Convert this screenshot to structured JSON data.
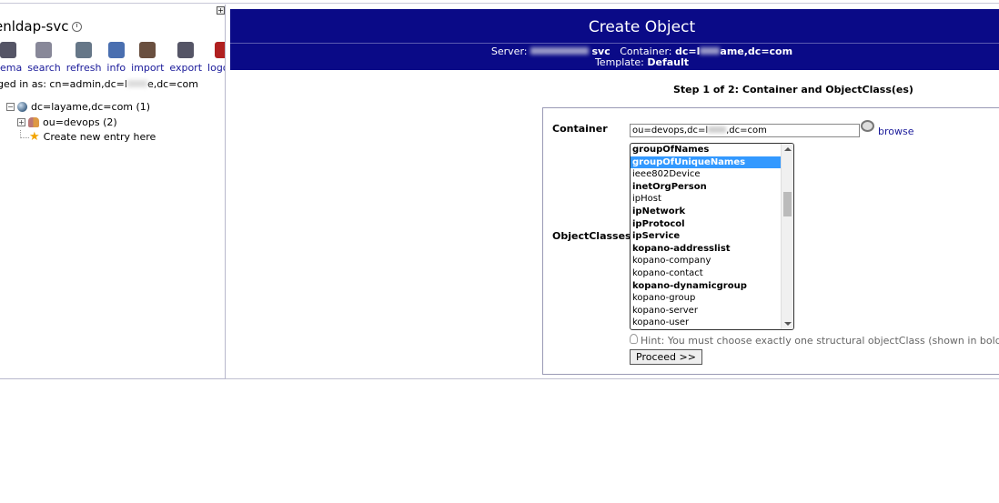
{
  "tree": {
    "server_name": "enldap-svc",
    "toolbar": [
      {
        "label": "hema",
        "icon": "schema-icon",
        "color": "#556"
      },
      {
        "label": "search",
        "icon": "search-icon",
        "color": "#889"
      },
      {
        "label": "refresh",
        "icon": "refresh-icon",
        "color": "#678"
      },
      {
        "label": "info",
        "icon": "info-icon",
        "color": "#4a6fb0"
      },
      {
        "label": "import",
        "icon": "import-icon",
        "color": "#6a5040"
      },
      {
        "label": "export",
        "icon": "export-icon",
        "color": "#556"
      },
      {
        "label": "logout",
        "icon": "logout-icon",
        "color": "#b02020"
      }
    ],
    "logged_in_text": "ged in as: cn=admin,dc=l",
    "logged_in_suffix": "e,dc=com",
    "root_node": "dc=layame,dc=com (1)",
    "child_node": "ou=devops (2)",
    "create_entry": "Create new entry here"
  },
  "header": {
    "title": "Create Object",
    "server_label": "Server:",
    "server_value": "svc",
    "container_label": "Container:",
    "container_value": "dc=l",
    "container_value_tail": "ame,dc=com",
    "template_label": "Template:",
    "template_value": "Default"
  },
  "form": {
    "step_title": "Step 1 of 2: Container and ObjectClass(es)",
    "container_label": "Container",
    "container_value": "ou=devops,dc=l",
    "container_value_tail": ",dc=com",
    "browse_label": "browse",
    "objectclasses_label": "ObjectClasses",
    "objectclasses": [
      {
        "name": "groupOfNames",
        "structural": true,
        "selected": false
      },
      {
        "name": "groupOfUniqueNames",
        "structural": true,
        "selected": true
      },
      {
        "name": "ieee802Device",
        "structural": false,
        "selected": false
      },
      {
        "name": "inetOrgPerson",
        "structural": true,
        "selected": false
      },
      {
        "name": "ipHost",
        "structural": false,
        "selected": false
      },
      {
        "name": "ipNetwork",
        "structural": true,
        "selected": false
      },
      {
        "name": "ipProtocol",
        "structural": true,
        "selected": false
      },
      {
        "name": "ipService",
        "structural": true,
        "selected": false
      },
      {
        "name": "kopano-addresslist",
        "structural": true,
        "selected": false
      },
      {
        "name": "kopano-company",
        "structural": false,
        "selected": false
      },
      {
        "name": "kopano-contact",
        "structural": false,
        "selected": false
      },
      {
        "name": "kopano-dynamicgroup",
        "structural": true,
        "selected": false
      },
      {
        "name": "kopano-group",
        "structural": false,
        "selected": false
      },
      {
        "name": "kopano-server",
        "structural": false,
        "selected": false
      },
      {
        "name": "kopano-user",
        "structural": false,
        "selected": false
      }
    ],
    "hint": "Hint: You must choose exactly one structural objectClass (shown in bold ab",
    "proceed_label": "Proceed >>"
  }
}
